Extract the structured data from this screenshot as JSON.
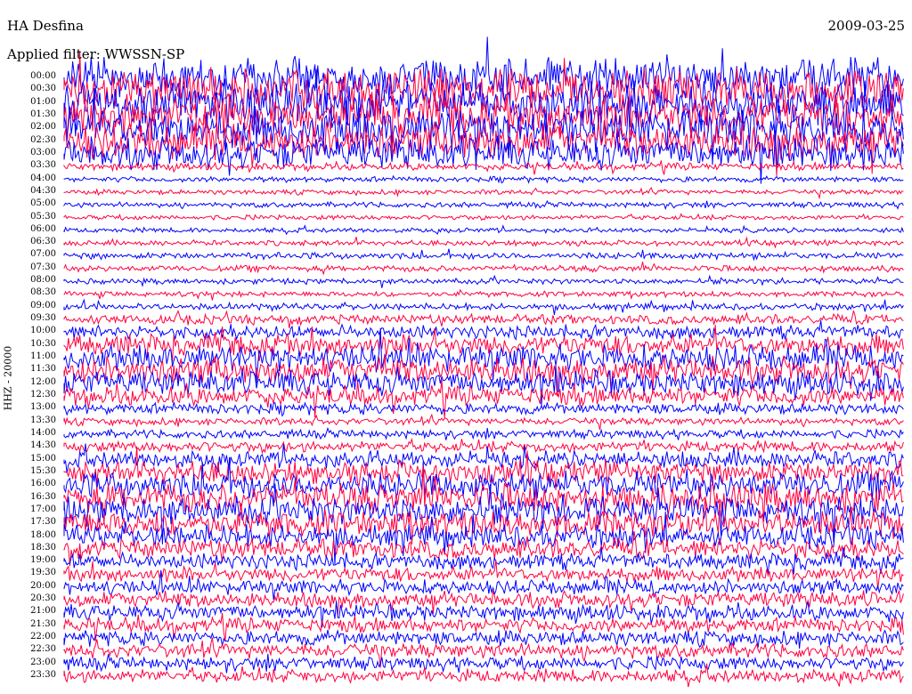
{
  "header": {
    "station": "HA Desfina",
    "date": "2009-03-25",
    "filter": "Applied filter: WWSSN-SP"
  },
  "chart_data": {
    "type": "line",
    "title": "HA Desfina",
    "date": "2009-03-25",
    "ylabel": "HHZ - 20000",
    "y_tick_labels": [
      "00:00",
      "00:30",
      "01:00",
      "01:30",
      "02:00",
      "02:30",
      "03:00",
      "03:30",
      "04:00",
      "04:30",
      "05:00",
      "05:30",
      "06:00",
      "06:30",
      "07:00",
      "07:30",
      "08:00",
      "08:30",
      "09:00",
      "09:30",
      "10:00",
      "10:30",
      "11:00",
      "11:30",
      "12:00",
      "12:30",
      "13:00",
      "13:30",
      "14:00",
      "14:30",
      "15:00",
      "15:30",
      "16:00",
      "16:30",
      "17:00",
      "17:30",
      "18:00",
      "18:30",
      "19:00",
      "19:30",
      "20:00",
      "20:30",
      "21:00",
      "21:30",
      "22:00",
      "22:30",
      "23:00",
      "23:30"
    ],
    "series_colors": [
      "#0000ff",
      "#ff0040"
    ],
    "trace_interval_minutes": 30,
    "relative_amplitude_per_trace": [
      3.2,
      3.4,
      3.5,
      3.3,
      3.4,
      3.0,
      2.6,
      0.6,
      0.45,
      0.4,
      0.45,
      0.4,
      0.4,
      0.45,
      0.55,
      0.5,
      0.45,
      0.45,
      0.55,
      0.8,
      1.1,
      1.7,
      2.1,
      2.2,
      2.0,
      1.6,
      0.9,
      0.6,
      0.7,
      0.9,
      1.4,
      1.9,
      2.2,
      2.4,
      2.3,
      2.2,
      1.9,
      1.6,
      1.3,
      1.2,
      1.2,
      1.3,
      1.3,
      1.2,
      1.2,
      1.2,
      1.1,
      1.1
    ]
  }
}
